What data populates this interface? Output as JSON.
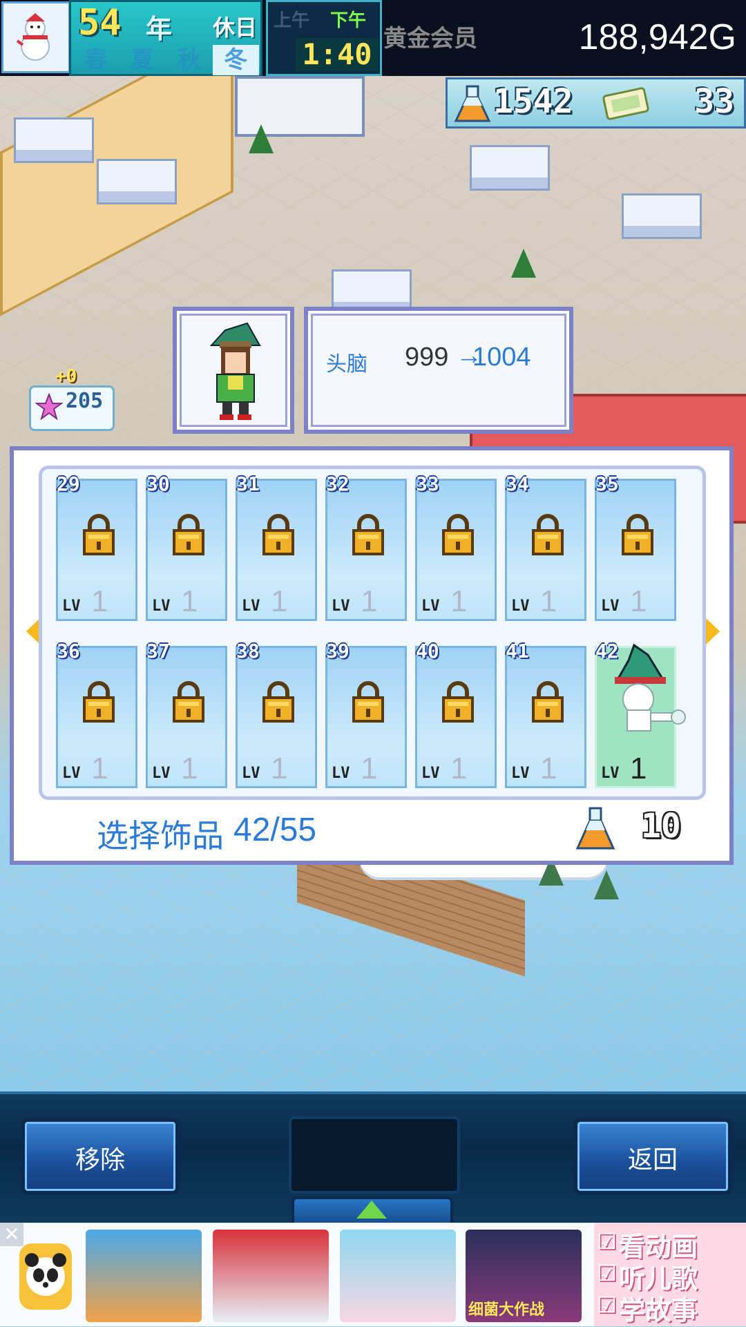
{
  "hud": {
    "year": "54",
    "year_label": "年",
    "holiday": "休日",
    "seasons": [
      "春",
      "夏",
      "秋",
      "冬"
    ],
    "active_season": "冬",
    "am": "上午",
    "pm": "下午",
    "time": "1:40",
    "member": "黄金会员",
    "gold": "188,942G",
    "research_points": "1542",
    "tickets": "33"
  },
  "character_badge": {
    "plus": "+0",
    "value": "205"
  },
  "stat_popup": {
    "label": "头脑",
    "old_value": "999",
    "arrow": "→",
    "new_value": "1004"
  },
  "accessory_panel": {
    "slots": [
      {
        "number": "29",
        "lv_label": "LV",
        "level": "1",
        "locked": true
      },
      {
        "number": "30",
        "lv_label": "LV",
        "level": "1",
        "locked": true
      },
      {
        "number": "31",
        "lv_label": "LV",
        "level": "1",
        "locked": true
      },
      {
        "number": "32",
        "lv_label": "LV",
        "level": "1",
        "locked": true
      },
      {
        "number": "33",
        "lv_label": "LV",
        "level": "1",
        "locked": true
      },
      {
        "number": "34",
        "lv_label": "LV",
        "level": "1",
        "locked": true
      },
      {
        "number": "35",
        "lv_label": "LV",
        "level": "1",
        "locked": true
      },
      {
        "number": "36",
        "lv_label": "LV",
        "level": "1",
        "locked": true
      },
      {
        "number": "37",
        "lv_label": "LV",
        "level": "1",
        "locked": true
      },
      {
        "number": "38",
        "lv_label": "LV",
        "level": "1",
        "locked": true
      },
      {
        "number": "39",
        "lv_label": "LV",
        "level": "1",
        "locked": true
      },
      {
        "number": "40",
        "lv_label": "LV",
        "level": "1",
        "locked": true
      },
      {
        "number": "41",
        "lv_label": "LV",
        "level": "1",
        "locked": true
      },
      {
        "number": "42",
        "lv_label": "LV",
        "level": "1",
        "locked": false,
        "selected": true
      }
    ],
    "select_label": "选择饰品",
    "select_count": "42/55",
    "cost": "10"
  },
  "controls": {
    "remove_label": "移除",
    "back_label": "返回"
  },
  "ad": {
    "close": "✕",
    "lines": [
      "看动画",
      "听儿歌",
      "学故事"
    ],
    "checks": [
      "☑",
      "☑",
      "☑"
    ],
    "game_title": "细菌大作战"
  },
  "colors": {
    "accent_blue": "#2c7ad8",
    "panel_border": "#7d82c8",
    "slot_fill": "#9fd2f5",
    "selected_slot": "#9fe3c3",
    "arrow_orange": "#f6b81b",
    "gold_text": "#ffffff"
  },
  "icons": {
    "snowman": "snowman-icon",
    "flask": "flask-icon",
    "ticket": "ticket-icon",
    "lock": "lock-icon",
    "arrow_left": "arrow-left-icon",
    "arrow_right": "arrow-right-icon"
  }
}
